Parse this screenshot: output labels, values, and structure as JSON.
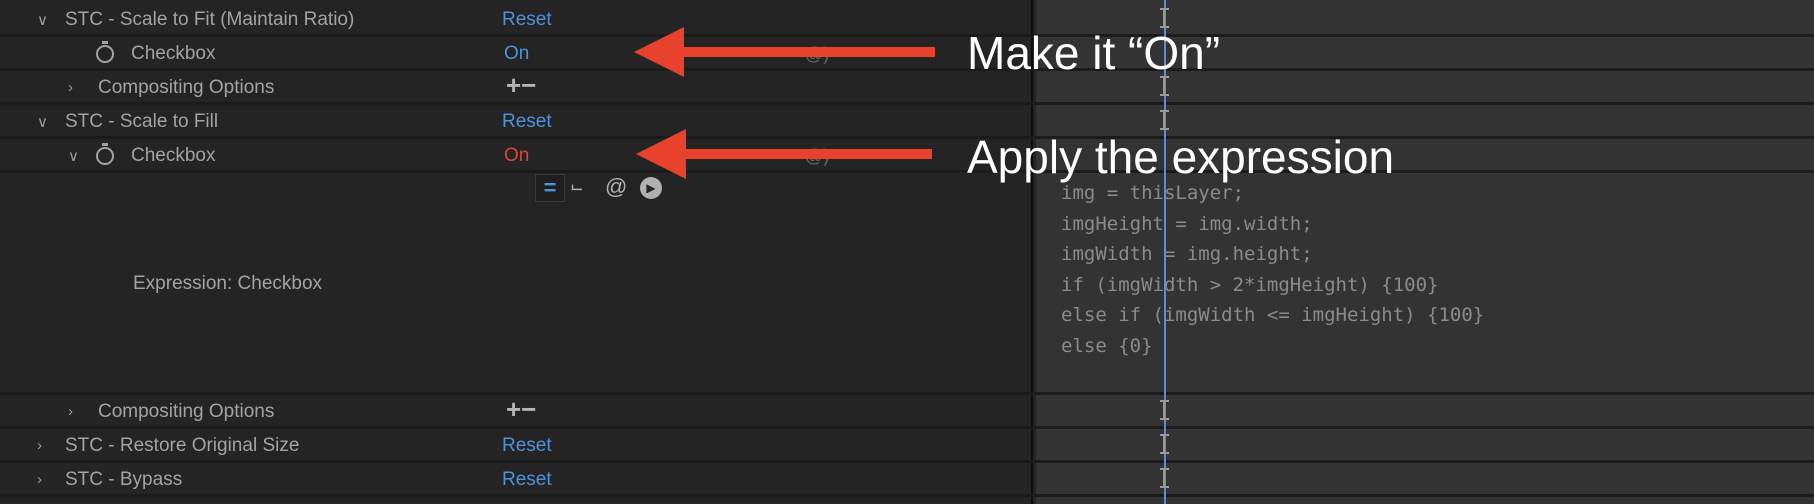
{
  "rows": [
    {
      "label": "STC - Scale to Fit (Maintain Ratio)",
      "value": "Reset"
    },
    {
      "label": "Checkbox",
      "value": "On"
    },
    {
      "label": "Compositing Options",
      "value": "+−"
    },
    {
      "label": "STC - Scale to Fill",
      "value": "Reset"
    },
    {
      "label": "Checkbox",
      "value": "On"
    },
    {
      "label": "Compositing Options",
      "value": "+−"
    },
    {
      "label": "STC - Restore Original Size",
      "value": "Reset"
    },
    {
      "label": "STC - Bypass",
      "value": "Reset"
    }
  ],
  "expression": {
    "label": "Expression: Checkbox",
    "code": [
      "img = thisLayer;",
      "imgHeight = img.width;",
      "imgWidth = img.height;",
      "if (imgWidth > 2*imgHeight) {100}",
      "else if (imgWidth <= imgHeight) {100}",
      "else {0}"
    ]
  },
  "annotations": [
    "Make it “On”",
    "Apply the expression"
  ],
  "colors": {
    "link": "#4f92dc",
    "expression_value": "#d34a38",
    "arrow": "#e8412c"
  }
}
